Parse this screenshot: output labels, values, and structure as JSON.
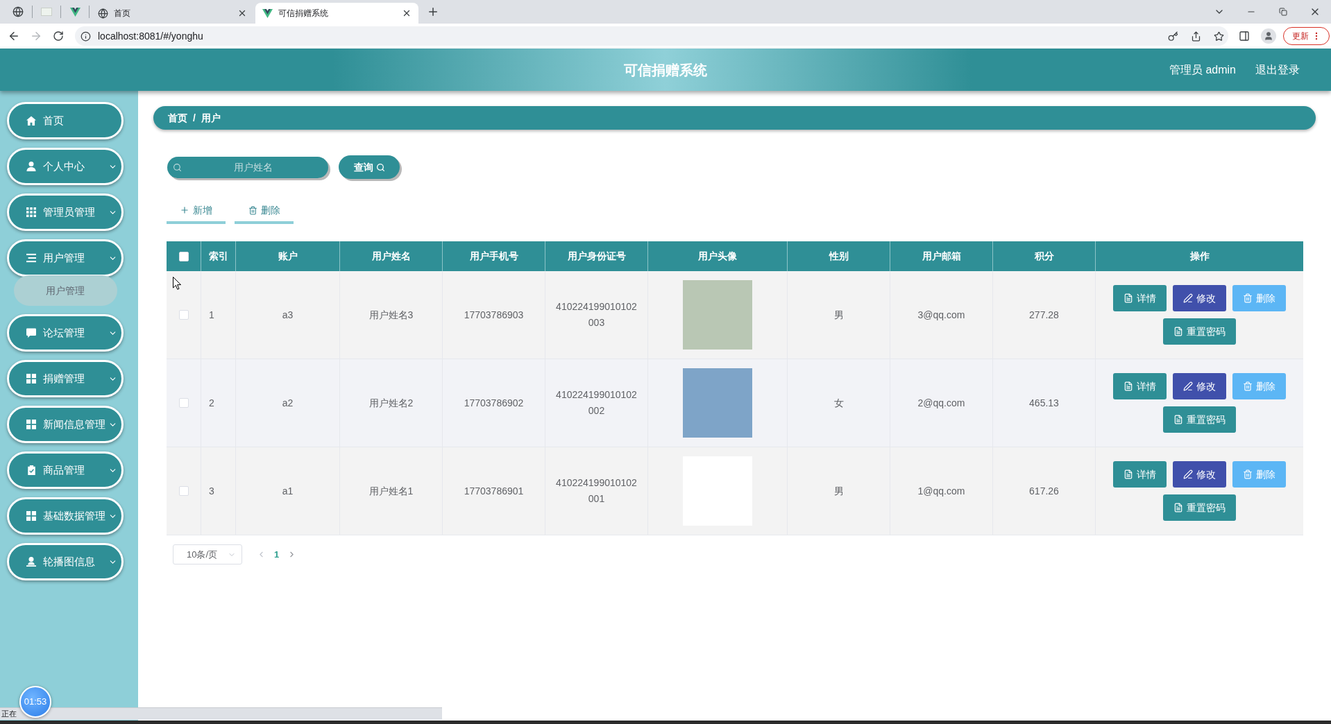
{
  "browser": {
    "tabs": [
      {
        "title": "首页",
        "selected": false
      },
      {
        "title": "可信捐赠系统",
        "selected": true
      }
    ],
    "address": "localhost:8081/#/yonghu",
    "forward_disabled": true,
    "update_button": "更新"
  },
  "header": {
    "title": "可信捐赠系统",
    "user": "管理员 admin",
    "logout": "退出登录"
  },
  "sidebar": {
    "items": [
      {
        "label": "首页",
        "kind": "link"
      },
      {
        "label": "个人中心",
        "kind": "submenu"
      },
      {
        "label": "管理员管理",
        "kind": "submenu"
      },
      {
        "label": "用户管理",
        "kind": "submenu",
        "children": [
          {
            "label": "用户管理",
            "selected": true
          }
        ]
      },
      {
        "label": "论坛管理",
        "kind": "submenu"
      },
      {
        "label": "捐赠管理",
        "kind": "submenu"
      },
      {
        "label": "新闻信息管理",
        "kind": "submenu"
      },
      {
        "label": "商品管理",
        "kind": "submenu"
      },
      {
        "label": "基础数据管理",
        "kind": "submenu"
      },
      {
        "label": "轮播图信息",
        "kind": "submenu"
      }
    ]
  },
  "breadcrumb": {
    "items": [
      "首页",
      "用户"
    ],
    "separator": "/"
  },
  "search": {
    "placeholder": "用户姓名",
    "button": "查询"
  },
  "toolbar": [
    {
      "label": "新增",
      "kind": "add"
    },
    {
      "label": "删除",
      "kind": "delete"
    }
  ],
  "table": {
    "select_all": {
      "checked": false
    },
    "columns": [
      "索引",
      "账户",
      "用户姓名",
      "用户手机号",
      "用户身份证号",
      "用户头像",
      "性别",
      "用户邮箱",
      "积分",
      "操作"
    ],
    "rows": [
      {
        "checked": false,
        "index": "1",
        "account": "a3",
        "name": "用户姓名3",
        "phone": "17703786903",
        "id_number": "410224199010102003",
        "gender": "男",
        "email": "3@qq.com",
        "points": "277.28",
        "actions": [
          {
            "label": "详情",
            "kind": "detail"
          },
          {
            "label": "修改",
            "kind": "edit"
          },
          {
            "label": "删除",
            "kind": "delete"
          },
          {
            "label": "重置密码",
            "kind": "reset"
          }
        ]
      },
      {
        "checked": false,
        "index": "2",
        "account": "a2",
        "name": "用户姓名2",
        "phone": "17703786902",
        "id_number": "410224199010102002",
        "gender": "女",
        "email": "2@qq.com",
        "points": "465.13",
        "actions": [
          {
            "label": "详情",
            "kind": "detail"
          },
          {
            "label": "修改",
            "kind": "edit"
          },
          {
            "label": "删除",
            "kind": "delete"
          },
          {
            "label": "重置密码",
            "kind": "reset"
          }
        ]
      },
      {
        "checked": false,
        "index": "3",
        "account": "a1",
        "name": "用户姓名1",
        "phone": "17703786901",
        "id_number": "410224199010102001",
        "gender": "男",
        "email": "1@qq.com",
        "points": "617.26",
        "actions": [
          {
            "label": "详情",
            "kind": "detail"
          },
          {
            "label": "修改",
            "kind": "edit"
          },
          {
            "label": "删除",
            "kind": "delete"
          },
          {
            "label": "重置密码",
            "kind": "reset"
          }
        ]
      }
    ]
  },
  "pagination": {
    "page_size": "10条/页",
    "pages": [
      {
        "label": "1",
        "selected": true
      }
    ]
  },
  "status_bar": {
    "text": "正在"
  },
  "timer": "01:53"
}
